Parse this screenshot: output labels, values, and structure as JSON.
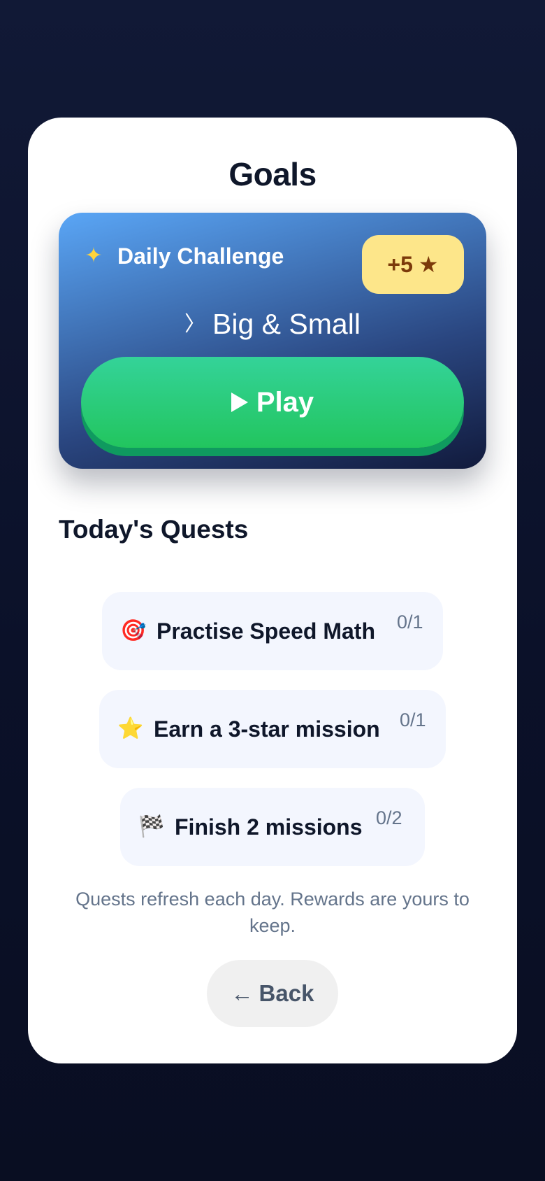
{
  "header": {
    "title": "Goals"
  },
  "daily_challenge": {
    "icon": "glowing-star-icon",
    "label": "Daily Challenge",
    "reward_text": "+5",
    "reward_icon": "star-icon",
    "mission_icon": "chevron-right-icon",
    "mission_name": "Big & Small",
    "play_label": "Play",
    "play_icon": "play-triangle-icon",
    "colors": {
      "card_gradient_top": "#5aa6f6",
      "card_gradient_bottom": "#111a3c",
      "reward_bg": "#fde68a",
      "play_green": "#22c55e"
    }
  },
  "quests": {
    "title": "Today's Quests",
    "items": [
      {
        "icon": "target-icon",
        "icon_glyph": "🎯",
        "label": "Practise Speed Math",
        "progress": "0/1"
      },
      {
        "icon": "star-icon",
        "icon_glyph": "⭐",
        "label": "Earn a 3-star mission",
        "progress": "0/1"
      },
      {
        "icon": "checkered-flag-icon",
        "icon_glyph": "🏁",
        "label": "Finish 2 missions",
        "progress": "0/2"
      }
    ],
    "footnote": "Quests refresh each day. Rewards are yours to keep."
  },
  "footer": {
    "back_label": "Back",
    "back_icon": "arrow-left-icon"
  }
}
